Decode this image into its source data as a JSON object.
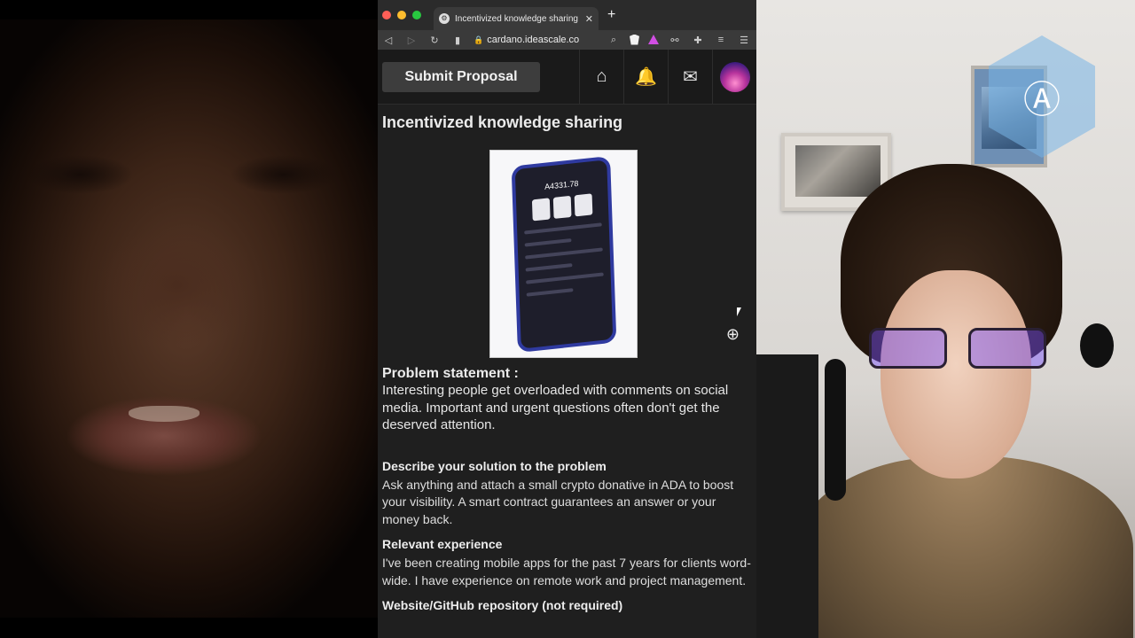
{
  "browser": {
    "tab": {
      "title": "Incentivized knowledge sharing"
    },
    "address": "cardano.ideascale.co"
  },
  "site": {
    "submit_label": "Submit Proposal",
    "icons": [
      "home-icon",
      "bell-icon",
      "mail-icon",
      "avatar"
    ]
  },
  "proposal": {
    "title": "Incentivized knowledge sharing",
    "image": {
      "balance": "A4331.78"
    },
    "problem_heading": "Problem statement :",
    "problem_text": "Interesting people get overloaded with comments on social media. Important and urgent questions often don't get the deserved attention.",
    "solution_heading": "Describe your solution to the problem",
    "solution_text": "Ask anything and attach a small crypto donative in ADA to boost your visibility. A smart contract guarantees an answer or your money back.",
    "experience_heading": "Relevant experience",
    "experience_text": "I've been creating mobile apps for the past 7 years for clients word-wide. I have experience on remote work and project management.",
    "website_heading": "Website/GitHub repository (not required)"
  },
  "colors": {
    "traffic_red": "#ff5f57",
    "traffic_yellow": "#febc2e",
    "traffic_green": "#28c840",
    "page_bg": "#1f1f1f",
    "accent_logo": "#78b4e6"
  }
}
